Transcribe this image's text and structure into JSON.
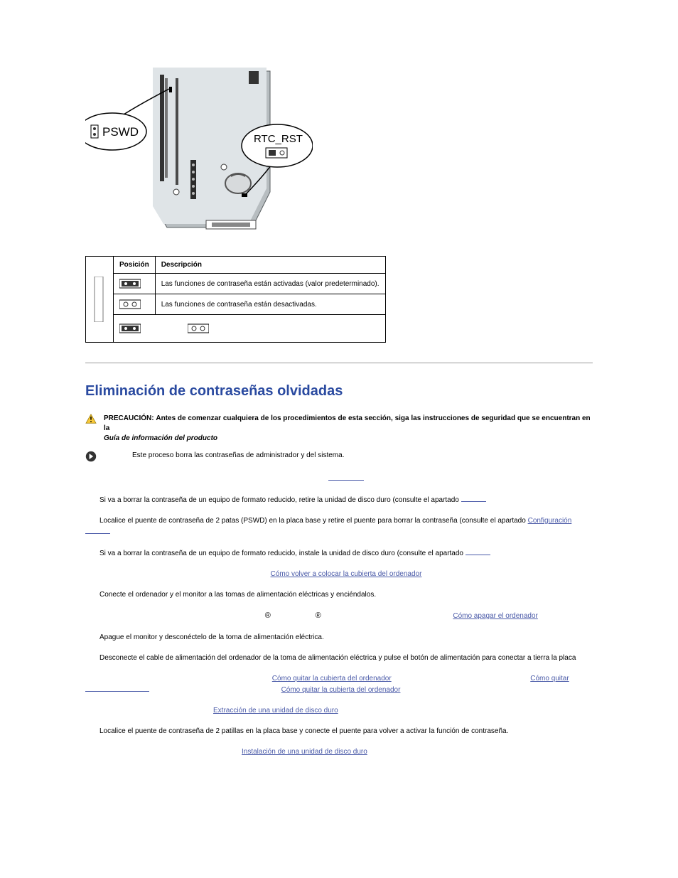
{
  "diagram": {
    "label_pswd": "PSWD",
    "label_rtcrst": "RTC_RST"
  },
  "table": {
    "header_pos": "Posición",
    "header_desc": "Descripción",
    "row1_desc": "Las funciones de contraseña están activadas (valor predeterminado).",
    "row2_desc": "Las funciones de contraseña están desactivadas."
  },
  "section_title": "Eliminación de contraseñas olvidadas",
  "warn": {
    "caution_label": "PRECAUCIÓN:",
    "caution_text": "Antes de comenzar cualquiera de los procedimientos de esta sección, siga las instrucciones de seguridad que se encuentran en la",
    "caution_guide": "Guía de información del producto",
    "notice_text": "Este proceso borra las contraseñas de administrador y del sistema."
  },
  "steps": {
    "s2": "Si va a borrar la contraseña de un equipo de formato reducido, retire la unidad de disco duro (consulte el apartado",
    "s3a": "Localice el puente de contraseña de 2 patas (PSWD) en la placa base y retire el puente para borrar la contraseña (consulte el apartado",
    "s3_link": "Configuración",
    "s4": "Si va a borrar la contraseña de un equipo de formato reducido, instale la unidad de disco duro (consulte el apartado",
    "s5_link": "Cómo volver a colocar la cubierta del ordenador",
    "s6": "Conecte el ordenador y el monitor a las tomas de alimentación eléctricas y enciéndalos.",
    "s7_link": "Cómo apagar el ordenador",
    "s8": "Apague el monitor y desconéctelo de la toma de alimentación eléctrica.",
    "s9": "Desconecte el cable de alimentación del ordenador de la toma de alimentación eléctrica y pulse el botón de alimentación para conectar a tierra la placa",
    "s10_link1": "Cómo quitar la cubierta del ordenador",
    "s10_link2": "Cómo quitar",
    "s10_link3": "Cómo quitar la cubierta del ordenador",
    "s11_link": "Extracción de una unidad de disco duro",
    "s12": "Localice el puente de contraseña de 2 patillas en la placa base y conecte el puente para volver a activar la función de contraseña.",
    "s13_link": "Instalación de una unidad de disco duro"
  }
}
